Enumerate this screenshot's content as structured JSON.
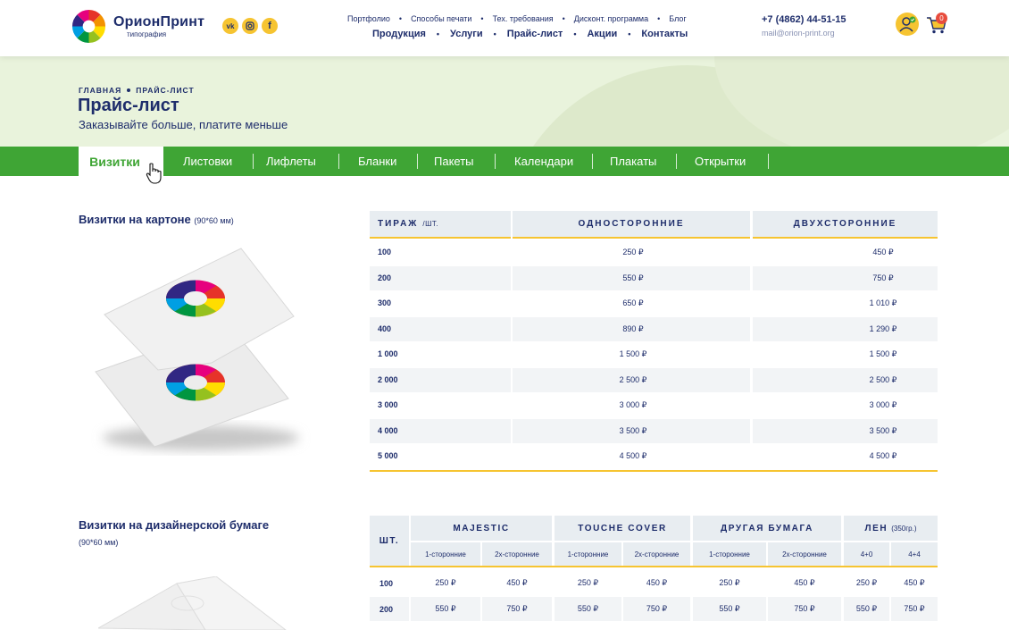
{
  "brand": {
    "name": "ОрионПринт",
    "tagline": "типография",
    "socials": [
      "vk",
      "instagram",
      "facebook"
    ]
  },
  "nav": {
    "secondary": [
      "Портфолио",
      "Способы печати",
      "Тех. требования",
      "Дисконт. программа",
      "Блог"
    ],
    "primary": [
      "Продукция",
      "Услуги",
      "Прайс-лист",
      "Акции",
      "Контакты"
    ]
  },
  "contacts": {
    "phone": "+7 (4862) 44-51-15",
    "email": "mail@orion-print.org"
  },
  "cart": {
    "count": "0"
  },
  "breadcrumb": [
    "ГЛАВНАЯ",
    "ПРАЙС-ЛИСТ"
  ],
  "page": {
    "title": "Прайс-лист",
    "subtitle": "Заказывайте больше, платите меньше"
  },
  "categories": {
    "active": "Визитки",
    "items": [
      "Листовки",
      "Лифлеты",
      "Бланки",
      "Пакеты",
      "Календари",
      "Плакаты",
      "Открытки"
    ]
  },
  "section1": {
    "title": "Визитки на картоне",
    "size": "(90*60 мм)",
    "table": {
      "headers": [
        "ТИРАЖ",
        "ОДНОСТОРОННИЕ",
        "ДВУХСТОРОННИЕ"
      ],
      "unit": "/ШТ.",
      "rows": [
        [
          "100",
          "250 ₽",
          "450 ₽"
        ],
        [
          "200",
          "550 ₽",
          "750 ₽"
        ],
        [
          "300",
          "650 ₽",
          "1 010 ₽"
        ],
        [
          "400",
          "890 ₽",
          "1 290 ₽"
        ],
        [
          "1 000",
          "1 500 ₽",
          "1 500 ₽"
        ],
        [
          "2 000",
          "2 500 ₽",
          "2 500 ₽"
        ],
        [
          "3 000",
          "3 000 ₽",
          "3 000 ₽"
        ],
        [
          "4 000",
          "3 500 ₽",
          "3 500 ₽"
        ],
        [
          "5 000",
          "4 500 ₽",
          "4 500 ₽"
        ]
      ]
    }
  },
  "section2": {
    "title": "Визитки на дизайнерской бумаге",
    "size": "(90*60 мм)",
    "table": {
      "qty_header": "ШТ.",
      "groups": [
        "MAJESTIC",
        "TOUCHE COVER",
        "ДРУГАЯ БУМАГА",
        "ЛЕН"
      ],
      "group_note": "(350гр.)",
      "subheaders": [
        "1-сторонние",
        "2х-сторонние",
        "1-сторонние",
        "2х-сторонние",
        "1-сторонние",
        "2х-сторонние",
        "4+0",
        "4+4"
      ],
      "rows": [
        [
          "100",
          "250 ₽",
          "450 ₽",
          "250 ₽",
          "450 ₽",
          "250 ₽",
          "450 ₽",
          "250 ₽",
          "450 ₽"
        ],
        [
          "200",
          "550 ₽",
          "750 ₽",
          "550 ₽",
          "750 ₽",
          "550 ₽",
          "750 ₽",
          "550 ₽",
          "750 ₽"
        ]
      ]
    }
  },
  "colors": {
    "brand_blue": "#1e2d6b",
    "accent_green": "#3fa535",
    "accent_yellow": "#f6c431",
    "hero_bg": "#e9f3dc",
    "table_header_bg": "#e8edf1"
  }
}
